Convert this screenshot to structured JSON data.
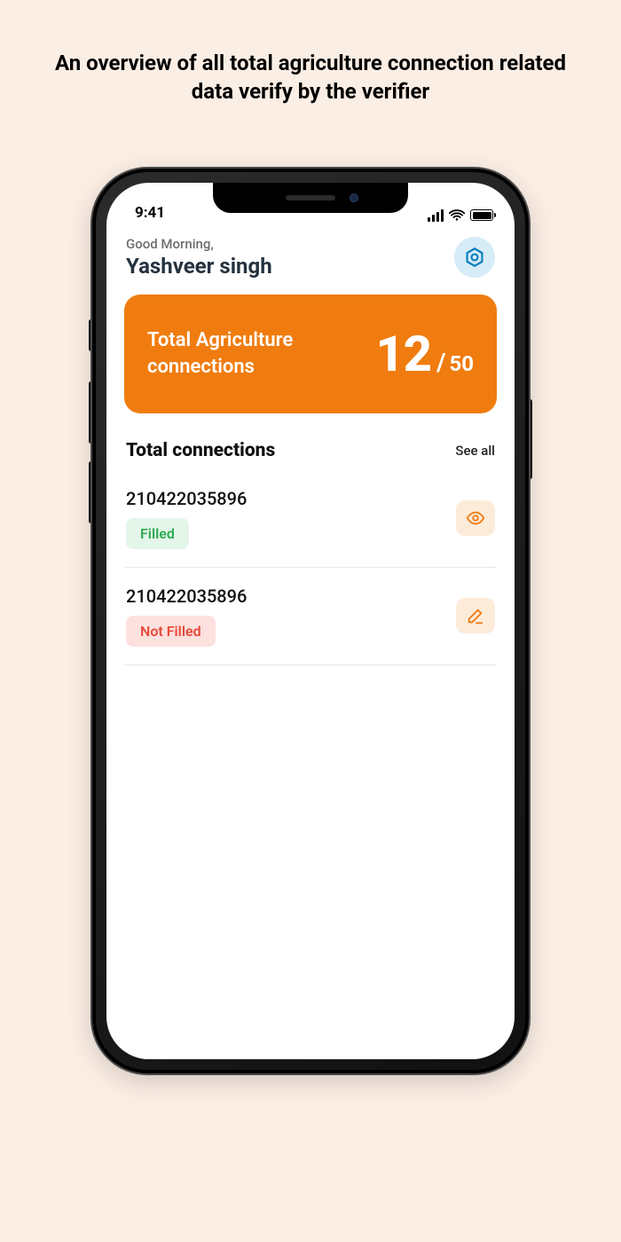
{
  "page": {
    "title": "An overview of all total agriculture connection related data verify by the verifier"
  },
  "statusbar": {
    "time": "9:41"
  },
  "header": {
    "greeting": "Good Morning,",
    "username": "Yashveer singh",
    "settings_icon": "settings-gear-icon"
  },
  "hero": {
    "label": "Total Agriculture connections",
    "count": "12",
    "total": "50",
    "separator": "/"
  },
  "section": {
    "title": "Total connections",
    "see_all": "See all"
  },
  "status_labels": {
    "filled": "Filled",
    "not_filled": "Not Filled"
  },
  "connections": [
    {
      "id": "210422035896",
      "status": "filled",
      "action_icon": "eye-icon"
    },
    {
      "id": "210422035896",
      "status": "notfilled",
      "action_icon": "edit-icon"
    }
  ],
  "colors": {
    "accent": "#f07c0f",
    "page_bg": "#fbeee4",
    "filled_fg": "#2cab55",
    "filled_bg": "#e4f5e9",
    "notfilled_fg": "#e64a3a",
    "notfilled_bg": "#fde1de",
    "settings_bg": "#d6ecf7",
    "settings_fg": "#0b7fbf"
  }
}
